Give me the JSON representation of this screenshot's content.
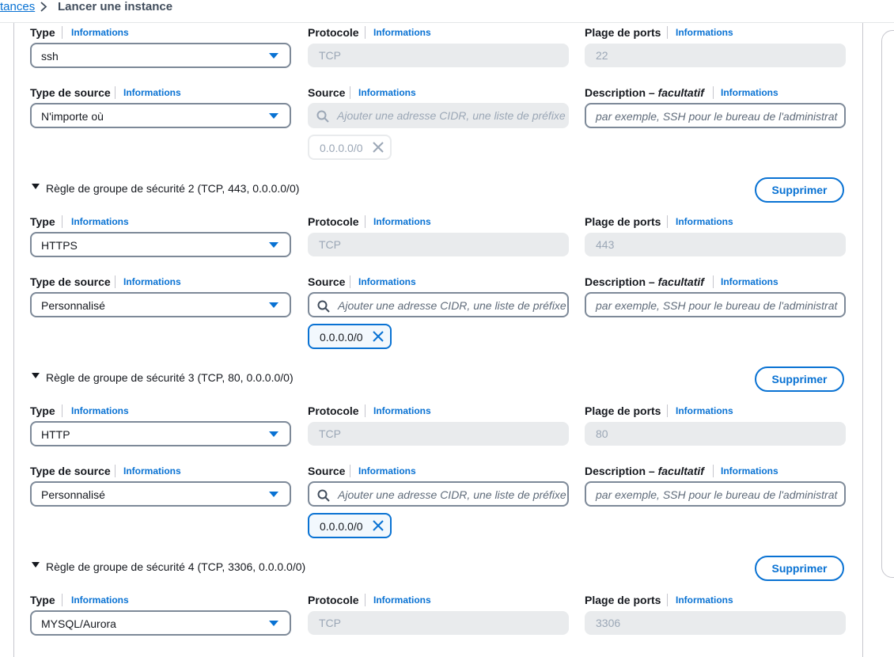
{
  "breadcrumb": {
    "parent": "tances",
    "current": "Lancer une instance"
  },
  "labels": {
    "type": "Type",
    "protocol": "Protocole",
    "port_range": "Plage de ports",
    "source_type": "Type de source",
    "source": "Source",
    "description": "Description",
    "description_dash": " – ",
    "optional": "facultatif",
    "info": "Informations",
    "source_placeholder": "Ajouter une adresse CIDR, une liste de préfixe",
    "description_placeholder": "par exemple, SSH pour le bureau de l'administrat",
    "remove_button": "Supprimer"
  },
  "rules": [
    {
      "type": "ssh",
      "protocol": "TCP",
      "port_range": "22",
      "source_type": "N'importe où",
      "source_token": "0.0.0.0/0",
      "source_disabled": true
    },
    {
      "header": "Règle de groupe de sécurité 2 (TCP, 443, 0.0.0.0/0)",
      "type": "HTTPS",
      "protocol": "TCP",
      "port_range": "443",
      "source_type": "Personnalisé",
      "source_token": "0.0.0.0/0",
      "source_disabled": false
    },
    {
      "header": "Règle de groupe de sécurité 3 (TCP, 80, 0.0.0.0/0)",
      "type": "HTTP",
      "protocol": "TCP",
      "port_range": "80",
      "source_type": "Personnalisé",
      "source_token": "0.0.0.0/0",
      "source_disabled": false
    },
    {
      "header": "Règle de groupe de sécurité 4 (TCP, 3306, 0.0.0.0/0)",
      "type": "MYSQL/Aurora",
      "protocol": "TCP",
      "port_range": "3306"
    }
  ],
  "colors": {
    "accent": "#0972d3",
    "text": "#16191f",
    "disabled_bg": "#e9ebed",
    "border": "#7d8998"
  }
}
